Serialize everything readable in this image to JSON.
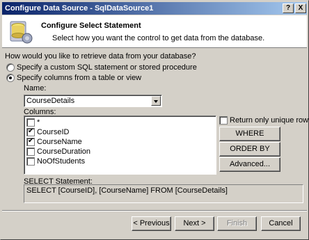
{
  "window": {
    "title": "Configure Data Source - SqlDataSource1",
    "help_label": "?",
    "close_label": "X"
  },
  "header": {
    "title": "Configure Select Statement",
    "subtitle": "Select how you want the control to get data from the database."
  },
  "question": "How would you like to retrieve data from your database?",
  "options": [
    {
      "label": "Specify a custom SQL statement or stored procedure",
      "selected": false
    },
    {
      "label": "Specify columns from a table or view",
      "selected": true
    }
  ],
  "name_label": "Name:",
  "name_value": "CourseDetails",
  "columns_label": "Columns:",
  "columns": [
    {
      "label": "*",
      "checked": false
    },
    {
      "label": "CourseID",
      "checked": true
    },
    {
      "label": "CourseName",
      "checked": true
    },
    {
      "label": "CourseDuration",
      "checked": false
    },
    {
      "label": "NoOfStudents",
      "checked": false
    }
  ],
  "unique_rows_label": "Return only unique rows",
  "side_buttons": {
    "where": "WHERE",
    "order_by": "ORDER BY",
    "advanced": "Advanced..."
  },
  "select_label": "SELECT Statement:",
  "select_statement": "SELECT [CourseID], [CourseName] FROM [CourseDetails]",
  "footer": {
    "previous": "< Previous",
    "next": "Next >",
    "finish": "Finish",
    "cancel": "Cancel"
  }
}
